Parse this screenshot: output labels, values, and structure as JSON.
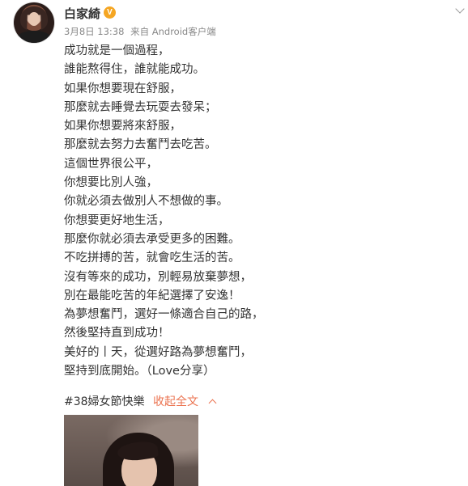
{
  "post": {
    "username": "白家綺",
    "verified_badge": "V",
    "date": "3月8日 13:38",
    "source": "来自 Android客户端",
    "body_lines": [
      "成功就是一個過程，",
      "誰能熬得住，誰就能成功。",
      "如果你想要現在舒服，",
      "那麼就去睡覺去玩耍去發呆；",
      "如果你想要將來舒服，",
      "那麼就去努力去奮鬥去吃苦。",
      "這個世界很公平，",
      "你想要比別人強，",
      "你就必須去做別人不想做的事。",
      "你想要更好地生活，",
      "那麼你就必須去承受更多的困難。",
      "不吃拼搏的苦，就會吃生活的苦。",
      "沒有等來的成功，別輕易放棄夢想，",
      "別在最能吃苦的年紀選擇了安逸！",
      "為夢想奮鬥，選好一條適合自己的路，",
      "然後堅持直到成功！",
      "美好的丨天，從選好路為夢想奮鬥，",
      "堅持到底開始。（Love分享）"
    ],
    "hashtag": "#38婦女節快樂",
    "collapse_label": "收起全文"
  },
  "colors": {
    "accent": "#eb7350",
    "badge": "#f5a623",
    "meta": "#888888",
    "text": "#333333"
  },
  "icons": {
    "verified": "verified-v-icon",
    "menu": "chevron-down-icon",
    "collapse": "chevron-up-icon"
  }
}
